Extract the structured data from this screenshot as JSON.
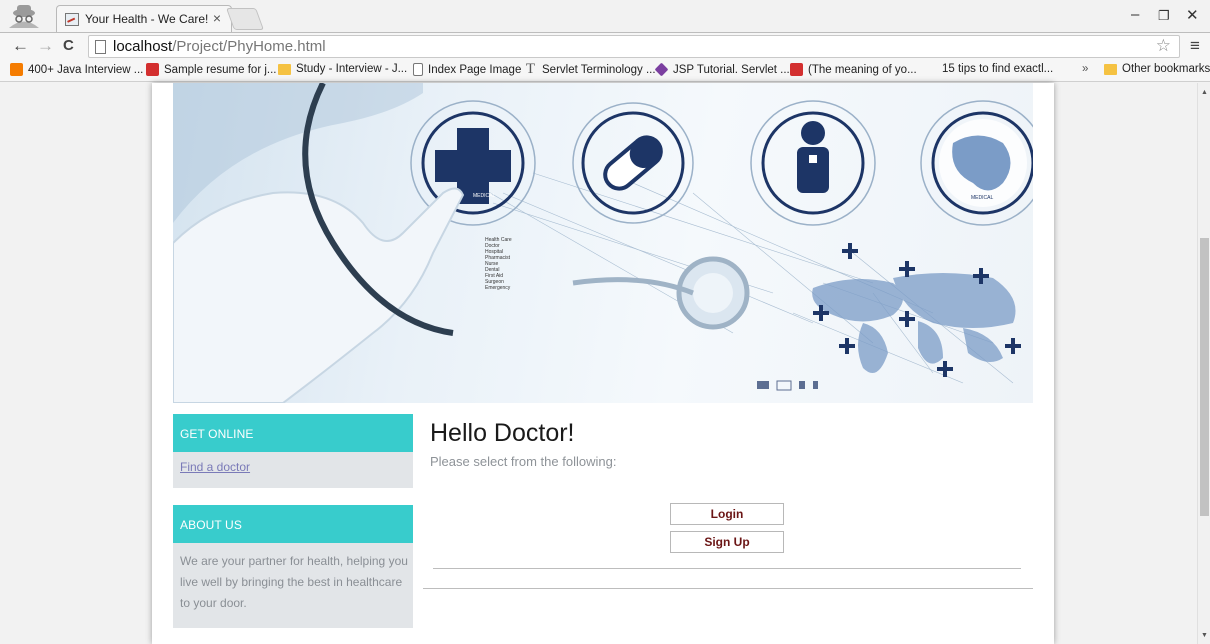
{
  "browser": {
    "tab_title": "Your Health - We Care!",
    "tab_close": "×",
    "url_host": "localhost",
    "url_path": "/Project/PhyHome.html",
    "window_controls": {
      "minimize": "–",
      "restore": "❐",
      "close": "✕"
    },
    "nav_icons": {
      "back": "←",
      "forward": "→",
      "reload": "C",
      "star": "☆",
      "menu": "≡"
    }
  },
  "bookmarks": {
    "items": [
      {
        "label": "400+ Java Interview ...",
        "icon": "blogger-icon"
      },
      {
        "label": "Sample resume for j...",
        "icon": "c-icon"
      },
      {
        "label": "Study - Interview - J...",
        "icon": "folder-icon"
      },
      {
        "label": "Index Page Image",
        "icon": "page-icon"
      },
      {
        "label": "Servlet Terminology ...",
        "icon": "t-icon"
      },
      {
        "label": "JSP Tutorial. Servlet ...",
        "icon": "jsp-icon"
      },
      {
        "label": "(The meaning of yo...",
        "icon": "red-icon"
      },
      {
        "label": "15 tips to find exactl...",
        "icon": "none"
      }
    ],
    "overflow": "»",
    "other": "Other bookmarks"
  },
  "banner": {
    "labels": [
      "MEDICAL",
      "MEDICAL"
    ],
    "list_text": [
      "Health Care",
      "Doctor",
      "Hospital",
      "Pharmacist",
      "Nurse",
      "Dental",
      "First Aid",
      "Surgeon",
      "Emergency"
    ],
    "colors": {
      "navy": "#1d3566",
      "sky": "#cfe0ee"
    }
  },
  "sidebar": {
    "get_online_heading": "GET ONLINE",
    "find_doctor_link": "Find a doctor",
    "about_heading": "ABOUT US",
    "about_text": "We are your partner for health, helping you live well by bringing the best in healthcare to your door.",
    "heading_color": "#38cccc"
  },
  "main": {
    "greeting": "Hello Doctor!",
    "instruction": "Please select from the following:",
    "login_label": "Login",
    "signup_label": "Sign Up"
  }
}
